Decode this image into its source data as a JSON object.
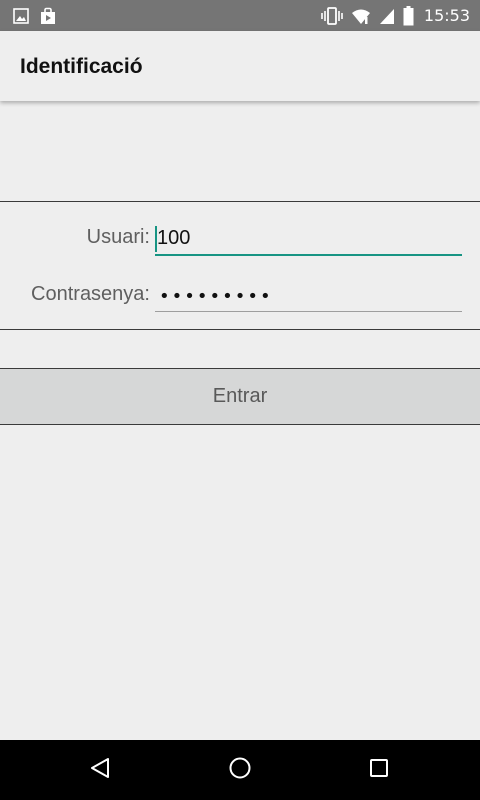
{
  "status_bar": {
    "time": "15:53",
    "icons": [
      "image-icon",
      "shopping-bag-icon",
      "vibrate-icon",
      "wifi-icon",
      "signal-icon",
      "battery-icon"
    ]
  },
  "app_bar": {
    "title": "Identificació"
  },
  "form": {
    "user_label": "Usuari:",
    "user_value": "100",
    "password_label": "Contrasenya:",
    "password_value": "•••••••••"
  },
  "button": {
    "label": "Entrar"
  },
  "nav_bar": {
    "icons": [
      "back-icon",
      "home-icon",
      "recents-icon"
    ]
  },
  "colors": {
    "accent": "#179483",
    "status_bar": "#757575",
    "background": "#eeeeee",
    "button": "#d6d7d7"
  }
}
